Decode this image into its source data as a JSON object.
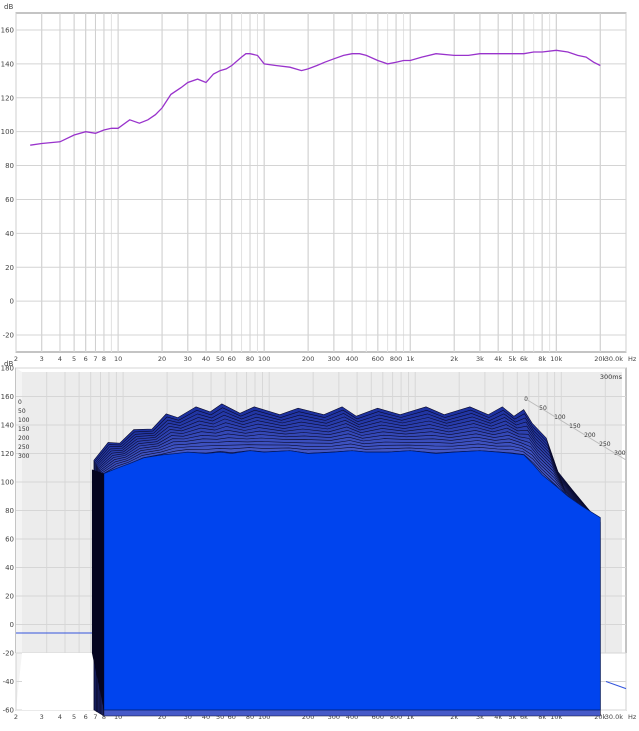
{
  "chart_data": [
    {
      "type": "line",
      "ylabel": "dB",
      "x_unit": "Hz",
      "x_scale": "log",
      "xlim": [
        2,
        30000
      ],
      "ylim": [
        -30,
        170
      ],
      "y_ticks": [
        160,
        140,
        120,
        100,
        80,
        60,
        40,
        20,
        0,
        -20
      ],
      "x_ticks": [
        "2",
        "3",
        "4",
        "5",
        "6",
        "7",
        "8",
        "10",
        "20",
        "30",
        "40",
        "50",
        "60",
        "80",
        "100",
        "200",
        "300",
        "400",
        "600",
        "800",
        "1k",
        "2k",
        "3k",
        "4k",
        "5k",
        "6k",
        "8k",
        "10k",
        "20k",
        "30.0k"
      ],
      "x_tick_values": [
        2,
        3,
        4,
        5,
        6,
        7,
        8,
        10,
        20,
        30,
        40,
        50,
        60,
        80,
        100,
        200,
        300,
        400,
        600,
        800,
        1000,
        2000,
        3000,
        4000,
        5000,
        6000,
        8000,
        10000,
        20000,
        30000
      ],
      "grid": true,
      "line_color": "#9933cc",
      "x": [
        2.5,
        3,
        4,
        5,
        6,
        7,
        8,
        9,
        10,
        12,
        14,
        16,
        18,
        20,
        23,
        27,
        30,
        35,
        40,
        45,
        50,
        55,
        60,
        70,
        75,
        80,
        90,
        100,
        120,
        150,
        180,
        200,
        230,
        260,
        300,
        350,
        400,
        450,
        500,
        600,
        700,
        800,
        900,
        1000,
        1200,
        1500,
        2000,
        2500,
        3000,
        4000,
        5000,
        6000,
        7000,
        8000,
        10000,
        12000,
        14000,
        16000,
        18000,
        20000
      ],
      "y": [
        92,
        93,
        94,
        98,
        100,
        99,
        101,
        102,
        102,
        107,
        105,
        107,
        110,
        114,
        122,
        126,
        129,
        131,
        129,
        134,
        136,
        137,
        139,
        144,
        146,
        146,
        145,
        140,
        139,
        138,
        136,
        137,
        139,
        141,
        143,
        145,
        146,
        146,
        145,
        142,
        140,
        141,
        142,
        142,
        144,
        146,
        145,
        145,
        146,
        146,
        146,
        146,
        147,
        147,
        148,
        147,
        145,
        144,
        141,
        139
      ]
    },
    {
      "type": "area",
      "ylabel": "dB",
      "x_unit": "Hz",
      "x_scale": "log",
      "xlim": [
        2,
        30000
      ],
      "ylim": [
        -60,
        180
      ],
      "y_ticks": [
        180,
        160,
        140,
        120,
        100,
        80,
        60,
        40,
        20,
        0,
        -20,
        -40,
        -60
      ],
      "x_ticks": [
        "2",
        "3",
        "4",
        "5",
        "6",
        "7",
        "8",
        "10",
        "20",
        "30",
        "40",
        "50",
        "60",
        "80",
        "100",
        "200",
        "300",
        "400",
        "600",
        "800",
        "1k",
        "2k",
        "3k",
        "4k",
        "5k",
        "6k",
        "8k",
        "10k",
        "20k",
        "30.0k"
      ],
      "x_tick_values": [
        2,
        3,
        4,
        5,
        6,
        7,
        8,
        10,
        20,
        30,
        40,
        50,
        60,
        80,
        100,
        200,
        300,
        400,
        600,
        800,
        1000,
        2000,
        3000,
        4000,
        5000,
        6000,
        8000,
        10000,
        20000,
        30000
      ],
      "time_unit": "ms",
      "time_ticks_left": [
        "0",
        "50",
        "100",
        "150",
        "200",
        "250",
        "300"
      ],
      "time_ticks_right": [
        "0",
        "50",
        "100",
        "150",
        "200",
        "250",
        "300"
      ],
      "time_label": "300ms",
      "fill_color": "#0044ee",
      "x": [
        8,
        10,
        12,
        15,
        20,
        25,
        30,
        40,
        50,
        60,
        80,
        100,
        150,
        200,
        300,
        400,
        500,
        700,
        1000,
        1500,
        2000,
        3000,
        4000,
        5000,
        6000,
        7000,
        8000,
        10000,
        12000,
        15000,
        20000
      ],
      "top_envelope": [
        118,
        125,
        130,
        134,
        140,
        145,
        148,
        150,
        152,
        152,
        151,
        150,
        150,
        149,
        150,
        150,
        149,
        149,
        150,
        150,
        150,
        150,
        150,
        150,
        149,
        148,
        144,
        128,
        110,
        92,
        82
      ],
      "front_floor": [
        106,
        110,
        113,
        117,
        119,
        120,
        121,
        120,
        121,
        120,
        122,
        121,
        122,
        120,
        121,
        122,
        121,
        121,
        122,
        120,
        121,
        122,
        121,
        120,
        119,
        112,
        105,
        97,
        90,
        83,
        75
      ]
    }
  ]
}
